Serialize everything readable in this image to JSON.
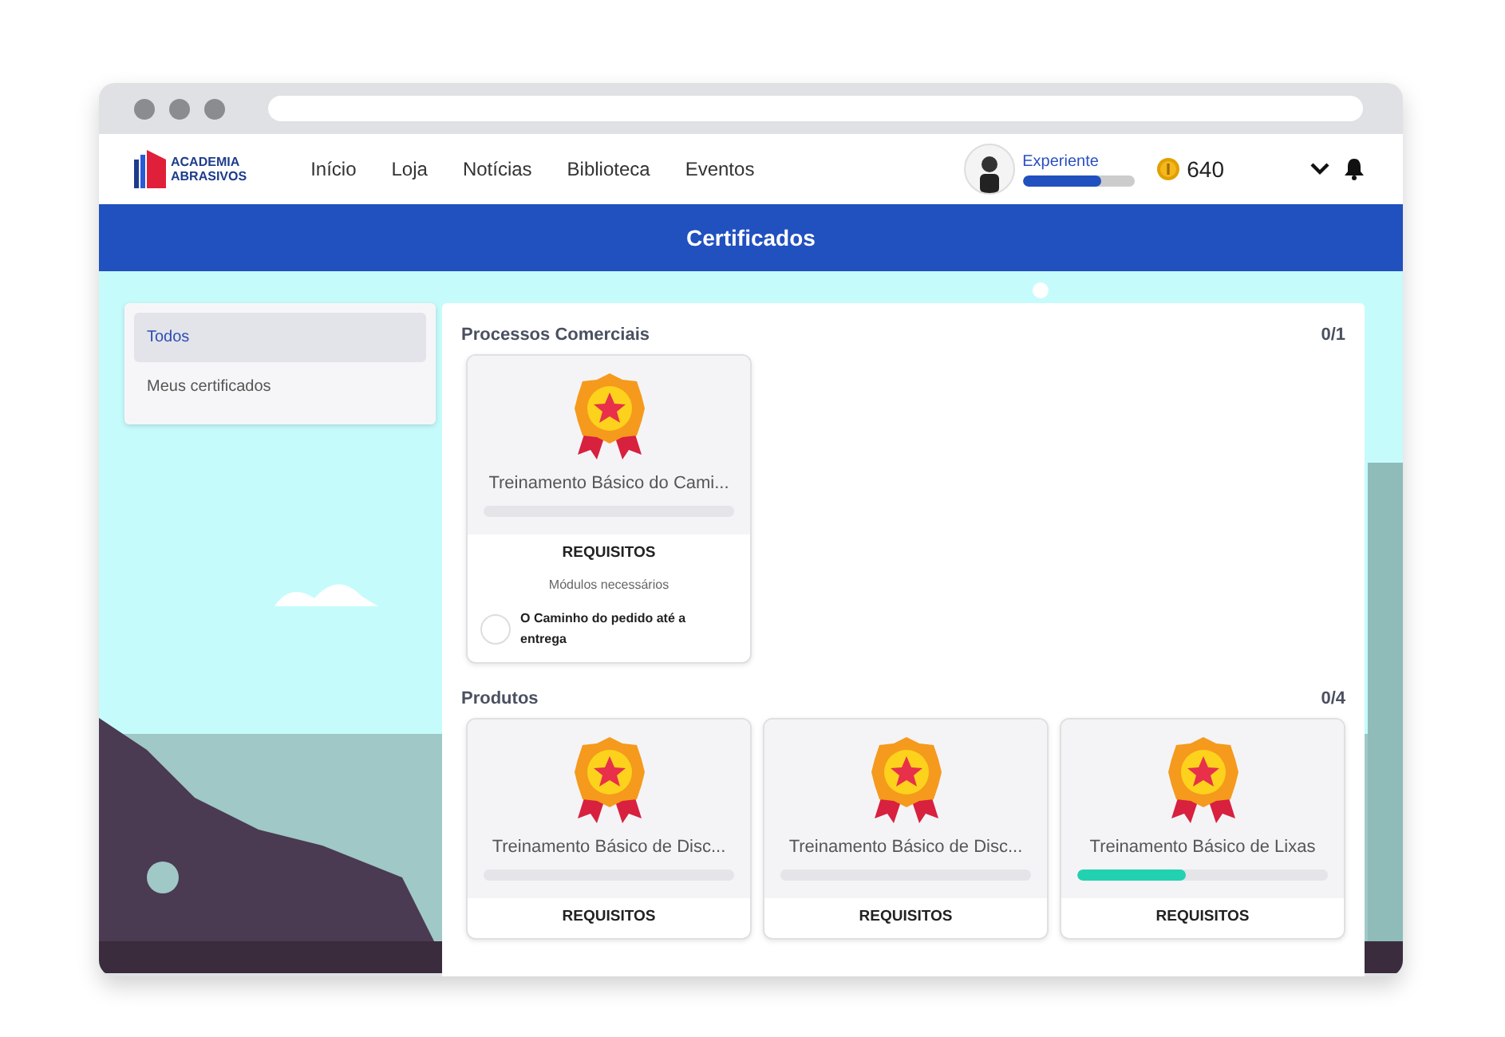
{
  "header": {
    "logo_lines": [
      "ACADEMIA",
      "ABRASIVOS"
    ],
    "nav": [
      "Início",
      "Loja",
      "Notícias",
      "Biblioteca",
      "Eventos"
    ],
    "profile": {
      "rank": "Experiente",
      "level": 0.7
    },
    "coins": "640"
  },
  "banner": {
    "title": "Certificados"
  },
  "sidebar": {
    "items": [
      {
        "label": "Todos",
        "selected": true
      },
      {
        "label": "Meus certificados",
        "selected": false
      }
    ]
  },
  "sections": [
    {
      "title": "Processos Comerciais",
      "count": "0/1",
      "cards": [
        {
          "title": "Treinamento Básico do Cami...",
          "level": 0,
          "requirements_heading": "REQUISITOS",
          "modules_label": "Módulos necessários",
          "modules": [
            {
              "name": "O Caminho do pedido até a entrega",
              "done": false
            }
          ]
        }
      ]
    },
    {
      "title": "Produtos",
      "count": "0/4",
      "cards": [
        {
          "title": "Treinamento Básico de Disc...",
          "level": 0,
          "requirements_heading": "REQUISITOS"
        },
        {
          "title": "Treinamento Básico de Disc...",
          "level": 0,
          "requirements_heading": "REQUISITOS"
        },
        {
          "title": "Treinamento Básico de Lixas",
          "level": 0.43,
          "requirements_heading": "REQUISITOS"
        }
      ]
    }
  ]
}
